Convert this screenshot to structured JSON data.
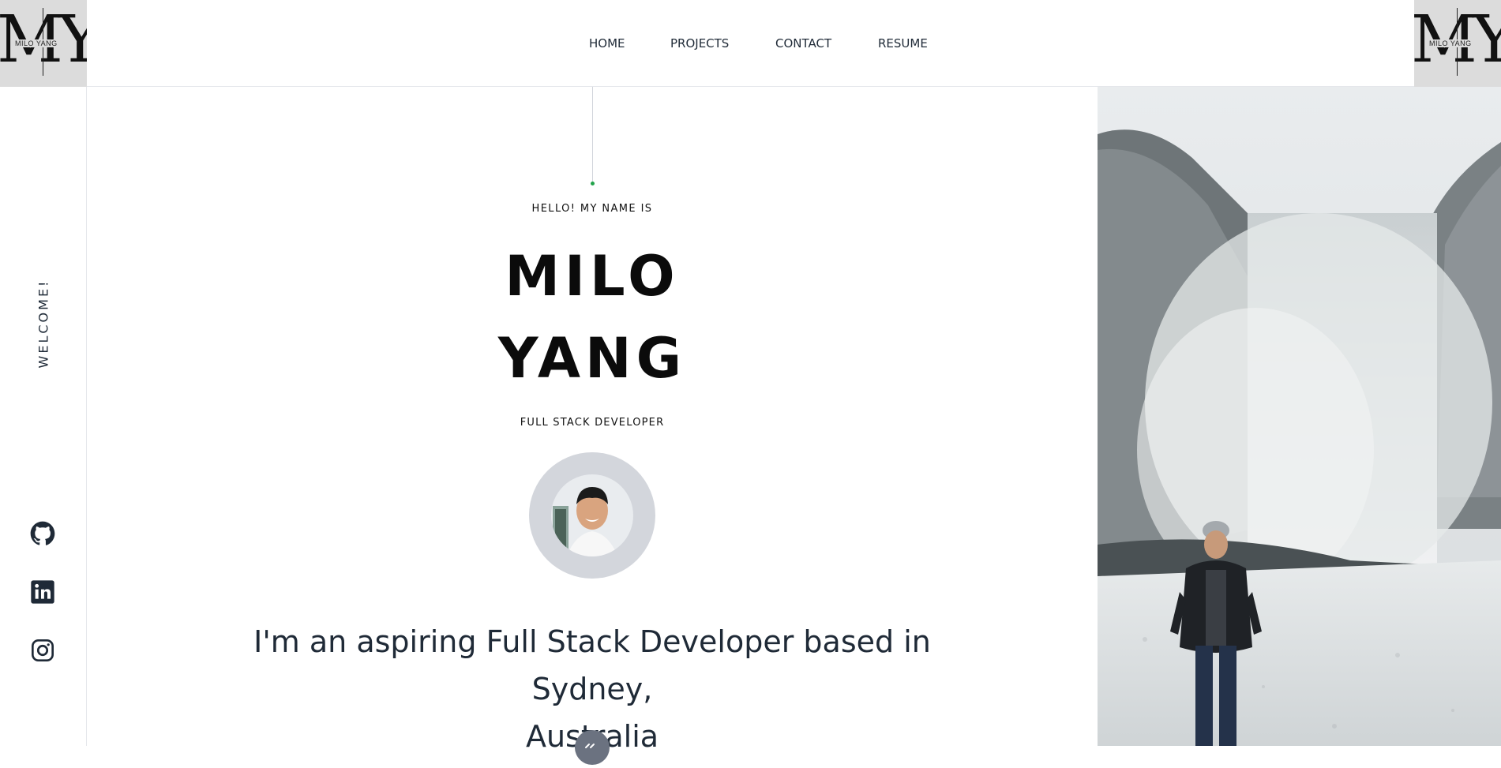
{
  "logo": {
    "monogram": "MY",
    "text": "MILO YANG"
  },
  "nav": {
    "items": [
      "HOME",
      "PROJECTS",
      "CONTACT",
      "RESUME"
    ]
  },
  "rail": {
    "welcome": "WELCOME!",
    "social": [
      "github-icon",
      "linkedin-icon",
      "instagram-icon"
    ]
  },
  "hero": {
    "greeting": "HELLO! MY NAME IS",
    "first_name": "MILO",
    "last_name": "YANG",
    "role": "FULL STACK DEVELOPER",
    "tagline_line1": "I'm an aspiring Full Stack Developer based in Sydney,",
    "tagline_line2": "Australia"
  },
  "colors": {
    "accent": "#22a34a",
    "text": "#1f2a37",
    "avatar_ring": "#d3d6dc"
  }
}
